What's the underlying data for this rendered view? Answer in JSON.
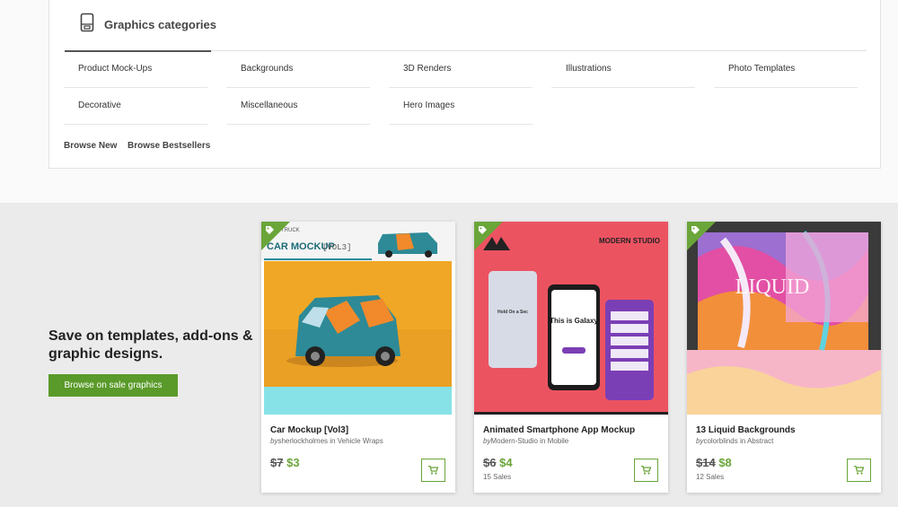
{
  "categories": {
    "tab_label": "Graphics categories",
    "links": [
      "Product Mock-Ups",
      "Backgrounds",
      "3D Renders",
      "Illustrations",
      "Photo Templates",
      "Decorative",
      "Miscellaneous",
      "Hero Images"
    ],
    "browse_new": "Browse New",
    "browse_bestsellers": "Browse Bestsellers"
  },
  "promo": {
    "title": "Save on templates, add-ons & graphic designs.",
    "button_label": "Browse on sale graphics"
  },
  "cards": [
    {
      "title": "Car Mockup [Vol3]",
      "by": "by",
      "author": "sherlockholmes",
      "in": "in",
      "category": "Vehicle Wraps",
      "old_price": "$7",
      "new_price": "$3",
      "sales": "",
      "thumb_title": "CAR MOCKUP",
      "thumb_sub": "[VOL3]",
      "thumb_top": "TRUCK"
    },
    {
      "title": "Animated Smartphone App Mockup",
      "by": "by",
      "author": "Modern-Studio",
      "in": "in",
      "category": "Mobile",
      "old_price": "$6",
      "new_price": "$4",
      "sales": "15 Sales",
      "thumb_brand": "MODERN STUDIO",
      "thumb_phone_text": "This is Galaxy",
      "thumb_left_text": "Hold On a Sec"
    },
    {
      "title": "13 Liquid Backgrounds",
      "by": "by",
      "author": "colorblinds",
      "in": "in",
      "category": "Abstract",
      "old_price": "$14",
      "new_price": "$8",
      "sales": "12 Sales",
      "thumb_word": "LIQUID"
    }
  ],
  "colors": {
    "accent_green": "#6aa539",
    "button_green": "#5a9a2a"
  },
  "icons": {
    "category_tab": "phone-doc-icon",
    "card_corner": "sale-tag-icon",
    "cart": "cart-icon"
  }
}
